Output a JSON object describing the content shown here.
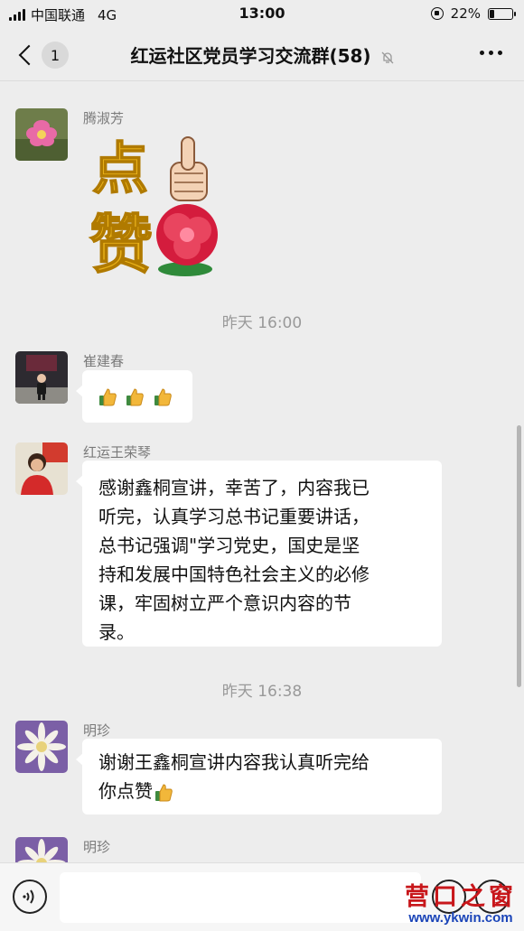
{
  "status_bar": {
    "carrier": "中国联通",
    "network": "4G",
    "time": "13:00",
    "battery": "22%",
    "battery_level": 0.22
  },
  "nav": {
    "back_count": "1",
    "title": "红运社区党员学习交流群(58)"
  },
  "messages": [
    {
      "sender": "腾淑芳",
      "type": "sticker",
      "sticker_text": [
        "点",
        "赞"
      ]
    },
    {
      "timestamp": "昨天 16:00"
    },
    {
      "sender": "崔建春",
      "type": "emoji",
      "emoji_count": 3
    },
    {
      "sender": "红运王荣琴",
      "type": "text",
      "lines": [
        "感谢鑫桐宣讲，幸苦了，内容我已",
        "听完，认真学习总书记重要讲话，",
        "总书记强调\"学习党史，国史是坚",
        "持和发展中国特色社会主义的必修",
        "课，牢固树立严个意识内容的节",
        "录。"
      ]
    },
    {
      "timestamp": "昨天 16:38"
    },
    {
      "sender": "明珍",
      "type": "text",
      "lines": [
        "谢谢王鑫桐宣讲内容我认真听完给",
        "你点赞"
      ]
    },
    {
      "sender": "明珍",
      "type": "partial"
    }
  ],
  "watermark": {
    "cn": "营口之窗",
    "url": "www.ykwin.com"
  },
  "colors": {
    "background": "#ededed",
    "bubble": "#ffffff",
    "watermark_red": "#c8171b",
    "watermark_blue": "#1a44b8"
  }
}
